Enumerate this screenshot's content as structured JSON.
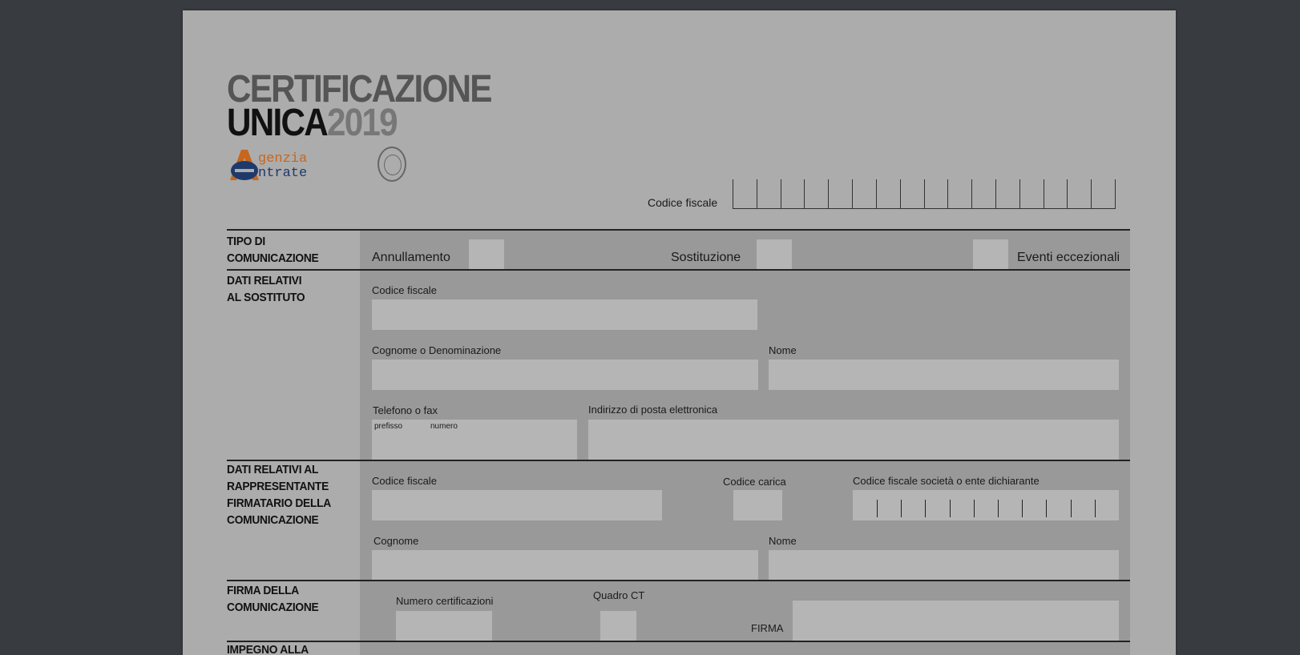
{
  "header": {
    "title_line1": "CERTIFICAZIONE",
    "title_line2": "UNICA",
    "title_year": "2019",
    "agency_line1": "genzia",
    "agency_line2": "ntrate"
  },
  "top": {
    "codice_fiscale_label": "Codice fiscale"
  },
  "tipo": {
    "section": "TIPO DI\nCOMUNICAZIONE",
    "annullamento": "Annullamento",
    "sostituzione": "Sostituzione",
    "eventi": "Eventi eccezionali"
  },
  "sostituto": {
    "section": "DATI RELATIVI\nAL SOSTITUTO",
    "codice_fiscale": "Codice fiscale",
    "cognome": "Cognome o Denominazione",
    "nome": "Nome",
    "telefono": "Telefono o fax",
    "prefisso": "prefisso",
    "numero": "numero",
    "email": "Indirizzo di posta elettronica"
  },
  "rappresentante": {
    "section": "DATI RELATIVI AL\nRAPPRESENTANTE\nFIRMATARIO DELLA\nCOMUNICAZIONE",
    "codice_fiscale": "Codice fiscale",
    "codice_carica": "Codice carica",
    "cf_societa": "Codice fiscale società o ente dichiarante",
    "cognome": "Cognome",
    "nome": "Nome"
  },
  "firma": {
    "section": "FIRMA DELLA\nCOMUNICAZIONE",
    "numero_cert": "Numero certificazioni",
    "quadro_ct": "Quadro CT",
    "firma": "FIRMA"
  },
  "impegno": {
    "section": "IMPEGNO ALLA\nPRESENTAZIONE"
  },
  "colors": {
    "page": "#acacac",
    "panel": "#999999",
    "field": "#b5b5b5",
    "backdrop": "#383c40"
  }
}
